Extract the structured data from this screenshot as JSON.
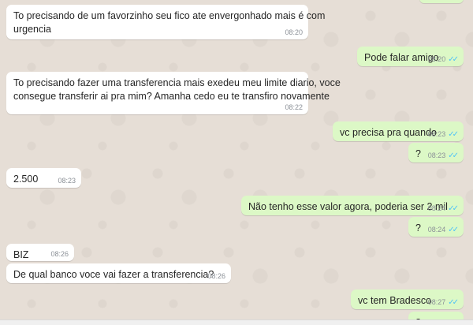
{
  "conversation": {
    "messages": [
      {
        "dir": "in",
        "line1": "To precisando de um favorzinho seu fico ate envergonhado mais é com",
        "line2": "urgencia",
        "time": "08:20"
      },
      {
        "dir": "out",
        "line1": "Pode falar amigo",
        "time": "08:20",
        "status": "read"
      },
      {
        "dir": "in",
        "line1": "To precisando fazer uma transferencia mais exedeu meu limite diario, voce",
        "line2": "consegue transferir ai pra mim? Amanha cedo eu te transfiro novamente",
        "time": "08:22"
      },
      {
        "dir": "out",
        "line1": "vc precisa pra quando",
        "time": "08:23",
        "status": "read"
      },
      {
        "dir": "out",
        "line1": "?",
        "time": "08:23",
        "status": "read"
      },
      {
        "dir": "in",
        "line1": "2.500",
        "time": "08:23"
      },
      {
        "dir": "out",
        "line1": "Não tenho esse valor agora, poderia ser 2 mil",
        "time": "08:24",
        "status": "read"
      },
      {
        "dir": "out",
        "line1": "?",
        "time": "08:24",
        "status": "read"
      },
      {
        "dir": "in",
        "line1": "BIZ",
        "time": "08:26"
      },
      {
        "dir": "in",
        "line1": "De qual banco voce vai fazer a transferencia?",
        "time": "08:26"
      },
      {
        "dir": "out",
        "line1": "vc tem Bradesco",
        "time": "08:27",
        "status": "read"
      },
      {
        "dir": "out",
        "line1": "?",
        "status": "sent"
      }
    ]
  },
  "icons": {
    "read_receipt": "double-check-icon",
    "status_color": "#4fc3f7"
  },
  "colors": {
    "incoming_bubble": "#ffffff",
    "outgoing_bubble": "#dcf8c6",
    "wallpaper": "#e6ded6"
  }
}
